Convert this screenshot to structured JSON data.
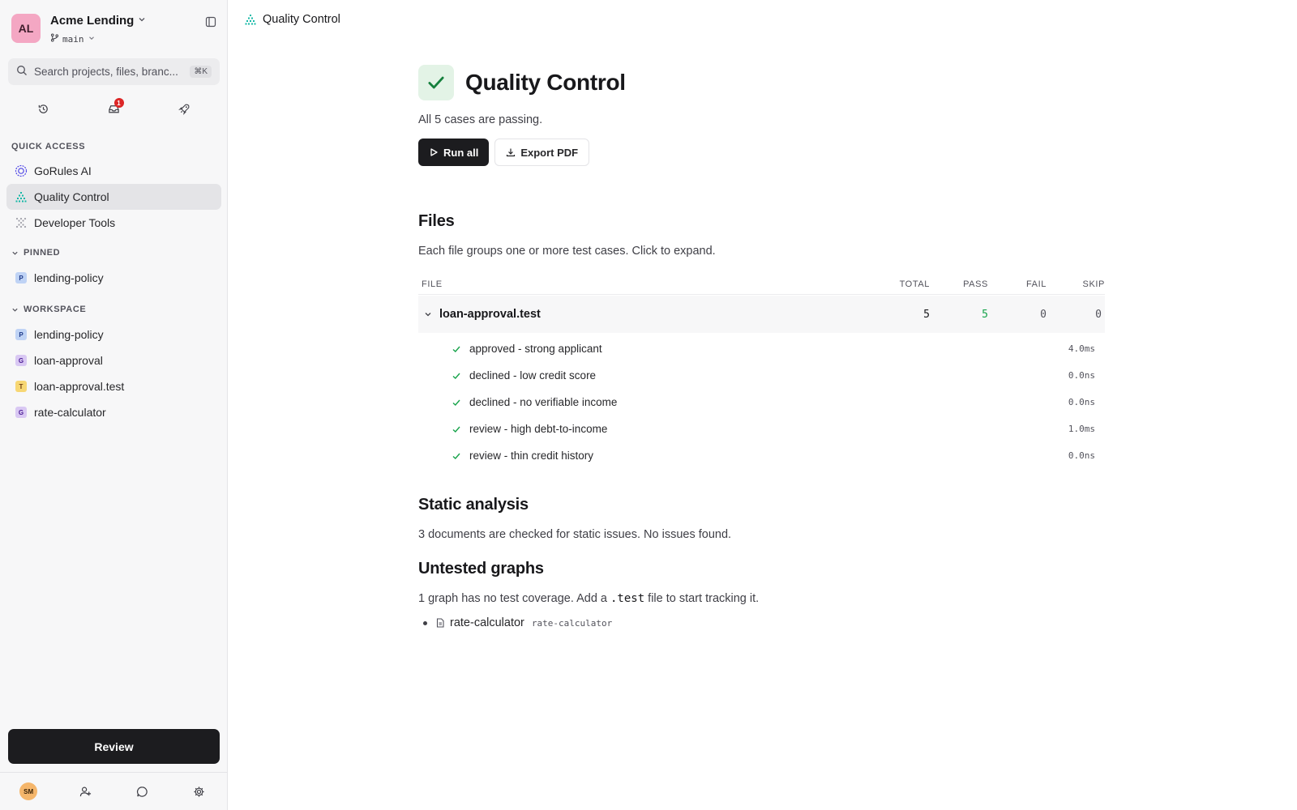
{
  "org": {
    "initials": "AL",
    "name": "Acme Lending",
    "branch": "main"
  },
  "search": {
    "placeholder": "Search projects, files, branc...",
    "shortcut": "⌘K"
  },
  "notifications": {
    "count": "1"
  },
  "sidebar": {
    "quick_access_label": "QUICK ACCESS",
    "quick_access": [
      {
        "label": "GoRules AI"
      },
      {
        "label": "Quality Control"
      },
      {
        "label": "Developer Tools"
      }
    ],
    "pinned_label": "PINNED",
    "pinned": [
      {
        "tag": "P",
        "label": "lending-policy"
      }
    ],
    "workspace_label": "WORKSPACE",
    "workspace": [
      {
        "tag": "P",
        "label": "lending-policy"
      },
      {
        "tag": "G",
        "label": "loan-approval"
      },
      {
        "tag": "T",
        "label": "loan-approval.test"
      },
      {
        "tag": "G",
        "label": "rate-calculator"
      }
    ],
    "review_label": "Review",
    "user_initials": "SM"
  },
  "breadcrumb": {
    "title": "Quality Control"
  },
  "page": {
    "title": "Quality Control",
    "subtitle": "All 5 cases are passing.",
    "run_all_label": "Run all",
    "export_label": "Export PDF"
  },
  "files": {
    "heading": "Files",
    "description": "Each file groups one or more test cases. Click to expand.",
    "columns": {
      "file": "FILE",
      "total": "TOTAL",
      "pass": "PASS",
      "fail": "FAIL",
      "skip": "SKIP"
    },
    "rows": [
      {
        "name": "loan-approval.test",
        "total": "5",
        "pass": "5",
        "fail": "0",
        "skip": "0",
        "cases": [
          {
            "name": "approved - strong applicant",
            "duration": "4.0ms"
          },
          {
            "name": "declined - low credit score",
            "duration": "0.0ns"
          },
          {
            "name": "declined - no verifiable income",
            "duration": "0.0ns"
          },
          {
            "name": "review - high debt-to-income",
            "duration": "1.0ms"
          },
          {
            "name": "review - thin credit history",
            "duration": "0.0ns"
          }
        ]
      }
    ]
  },
  "static_analysis": {
    "heading": "Static analysis",
    "description": "3 documents are checked for static issues. No issues found."
  },
  "untested": {
    "heading": "Untested graphs",
    "text_before": "1 graph has no test coverage. Add a ",
    "code": ".test",
    "text_after": " file to start tracking it.",
    "items": [
      {
        "name": "rate-calculator",
        "key": "rate-calculator"
      }
    ]
  },
  "colors": {
    "pass_green": "#16a34a",
    "accent_teal": "#14b8a6",
    "tag_p": "#bfd3f5",
    "tag_g": "#d9c8f3",
    "tag_t": "#f7d774"
  }
}
